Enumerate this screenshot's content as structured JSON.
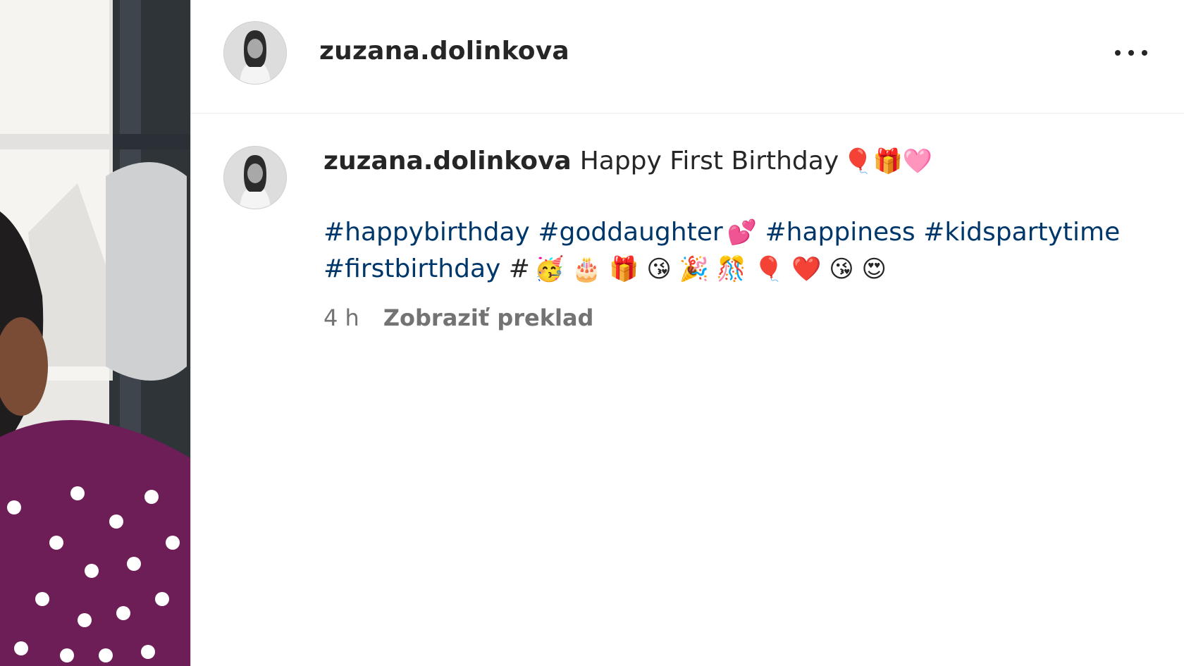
{
  "post": {
    "username": "zuzana.dolinkova",
    "caption_text": "Happy First Birthday",
    "caption_emoji": "🎈🎁🩷",
    "tags_line1": [
      {
        "text": "#happybirthday",
        "emoji": ""
      },
      {
        "text": "#goddaughter",
        "emoji": "💕"
      },
      {
        "text": "#happiness",
        "emoji": ""
      },
      {
        "text": "#kidspartytime",
        "emoji": ""
      }
    ],
    "tags_line2_tag": "#firstbirthday",
    "tags_line2_hash": "#",
    "tags_line2_emoji": "🥳 🎂 🎁 😘 🎉 🎊 🎈 ❤️ 😘 😍",
    "time": "4 h",
    "translate_label": "Zobraziť preklad"
  },
  "icons": {
    "more": "more-options-icon",
    "avatar": "profile-avatar"
  },
  "colors": {
    "hashtag": "#00376b",
    "text": "#262626",
    "muted": "#737373"
  }
}
